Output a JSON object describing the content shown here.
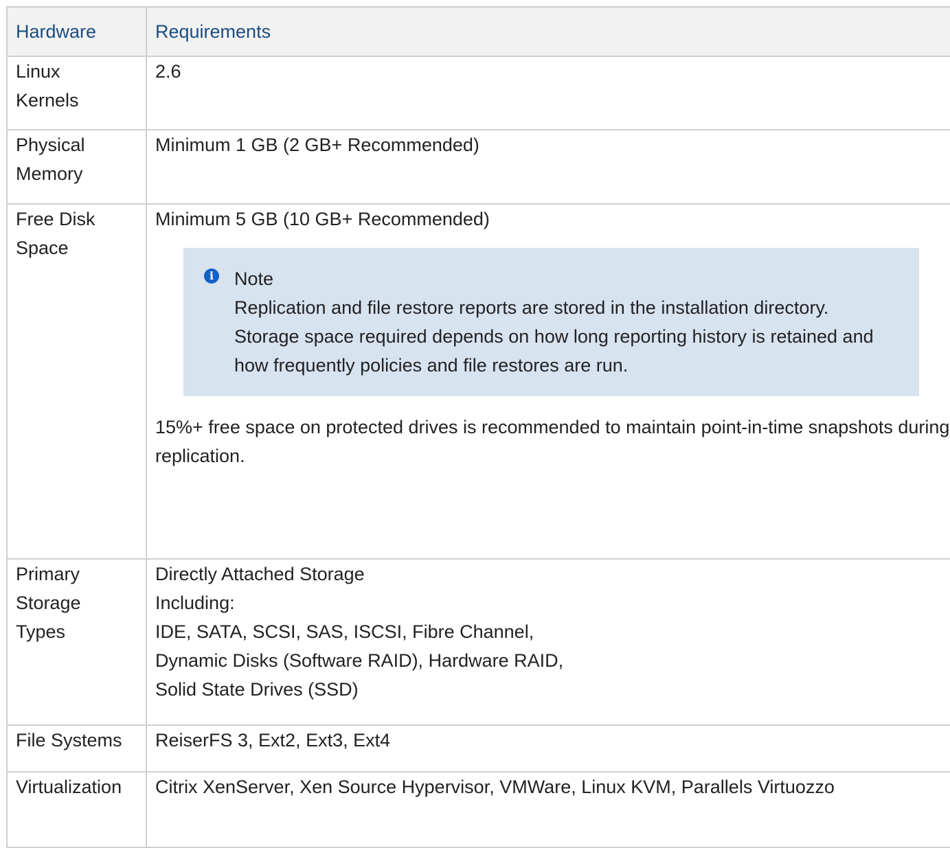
{
  "table": {
    "headers": [
      "Hardware",
      "Requirements"
    ],
    "rows": {
      "linux_kernels": {
        "label_lines": [
          "Linux",
          "Kernels"
        ],
        "value": "2.6"
      },
      "physical_memory": {
        "label_lines": [
          "Physical",
          "Memory"
        ],
        "value": "Minimum 1 GB (2 GB+ Recommended)"
      },
      "free_disk_space": {
        "label_lines": [
          "Free Disk",
          "Space"
        ],
        "value": "Minimum 5 GB (10 GB+ Recommended)",
        "note": {
          "icon": "info-icon",
          "title": "Note",
          "text": "Replication and file restore reports are stored in the installation directory. Storage space required depends on how long reporting history is retained and how frequently policies and file restores are run."
        },
        "extra": "15%+ free space on protected drives is recommended to maintain point-in-time snapshots during replication."
      },
      "primary_storage_types": {
        "label_lines": [
          "Primary",
          "Storage",
          "Types"
        ],
        "value_lines": [
          "Directly Attached Storage",
          "Including:",
          "IDE, SATA, SCSI, SAS, ISCSI, Fibre Channel,",
          "Dynamic Disks (Software RAID), Hardware RAID,",
          "Solid State Drives (SSD)"
        ]
      },
      "file_systems": {
        "label": "File Systems",
        "value": "ReiserFS 3, Ext2, Ext3, Ext4"
      },
      "virtualization": {
        "label": "Virtualization",
        "value": "Citrix XenServer, Xen Source Hypervisor, VMWare, Linux KVM, Parallels Virtuozzo"
      }
    }
  },
  "colors": {
    "header_text": "#1a4d80",
    "header_bg": "#f2f2f2",
    "border": "#cfcfcf",
    "note_bg": "#d8e3f0",
    "info_icon": "#1560c8"
  }
}
